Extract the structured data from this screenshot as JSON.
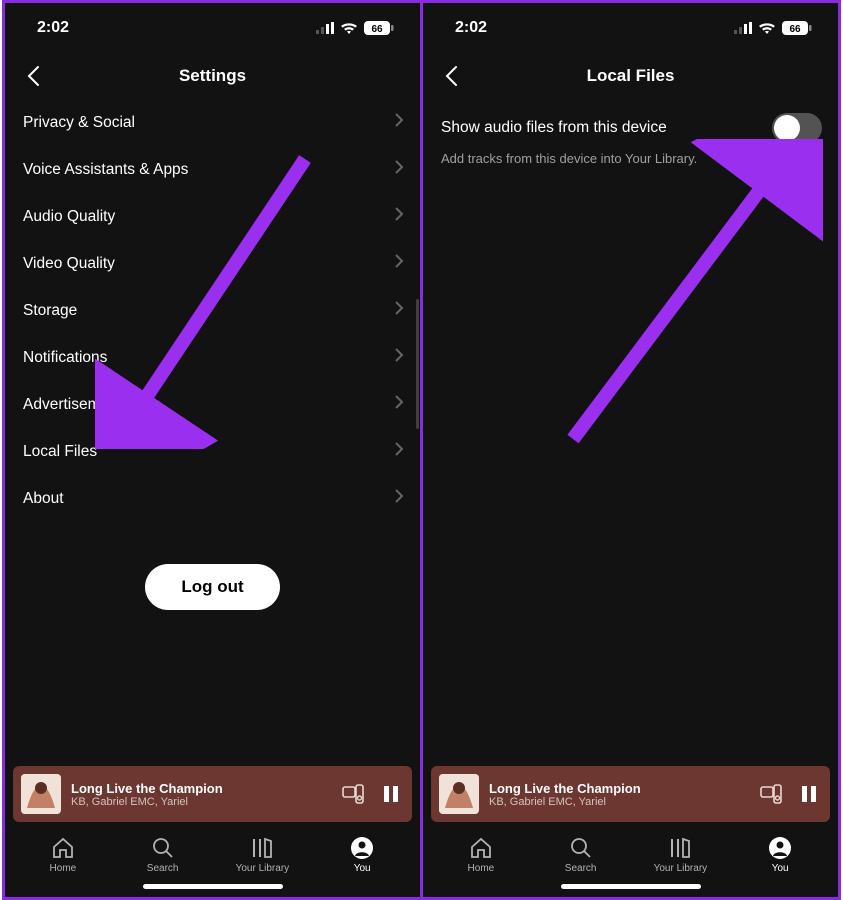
{
  "status": {
    "time": "2:02",
    "battery": "66"
  },
  "left": {
    "header": {
      "title": "Settings"
    },
    "items": [
      {
        "label": "Privacy & Social"
      },
      {
        "label": "Voice Assistants & Apps"
      },
      {
        "label": "Audio Quality"
      },
      {
        "label": "Video Quality"
      },
      {
        "label": "Storage"
      },
      {
        "label": "Notifications"
      },
      {
        "label": "Advertisements"
      },
      {
        "label": "Local Files"
      },
      {
        "label": "About"
      }
    ],
    "logout": "Log out"
  },
  "right": {
    "header": {
      "title": "Local Files"
    },
    "show_label": "Show audio files from this device",
    "show_sub": "Add tracks from this device into Your Library."
  },
  "now_playing": {
    "title": "Long Live the Champion",
    "artist": "KB, Gabriel EMC, Yariel"
  },
  "nav": {
    "home": "Home",
    "search": "Search",
    "library": "Your Library",
    "you": "You"
  }
}
